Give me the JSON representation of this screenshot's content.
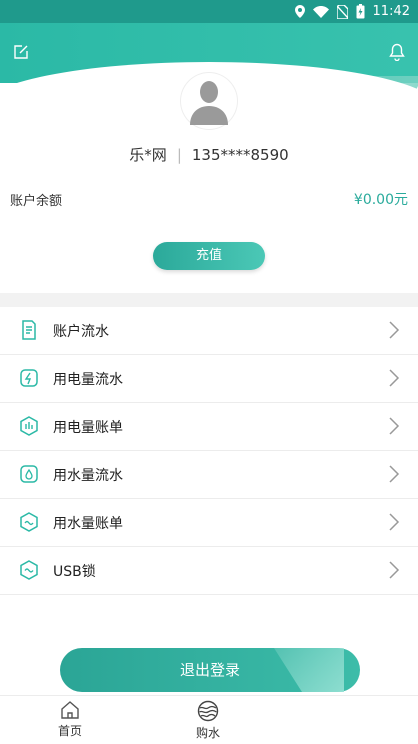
{
  "status_bar": {
    "time": "11:42"
  },
  "profile": {
    "name": "乐*网",
    "phone": "135****8590"
  },
  "balance": {
    "label": "账户余额",
    "value": "¥0.00元"
  },
  "recharge_label": "充值",
  "menu": [
    {
      "label": "账户流水",
      "icon": "ledger-icon"
    },
    {
      "label": "用电量流水",
      "icon": "electric-flow-icon"
    },
    {
      "label": "用电量账单",
      "icon": "electric-bill-icon"
    },
    {
      "label": "用水量流水",
      "icon": "water-flow-icon"
    },
    {
      "label": "用水量账单",
      "icon": "water-bill-icon"
    },
    {
      "label": "USB锁",
      "icon": "usb-lock-icon"
    }
  ],
  "logout_label": "退出登录",
  "tabs": [
    {
      "label": "首页",
      "icon": "home-icon"
    },
    {
      "label": "购水",
      "icon": "water-globe-icon"
    }
  ],
  "colors": {
    "accent": "#2bb9a6",
    "price": "#2aab9c",
    "status_bar": "#1f9a8c"
  }
}
